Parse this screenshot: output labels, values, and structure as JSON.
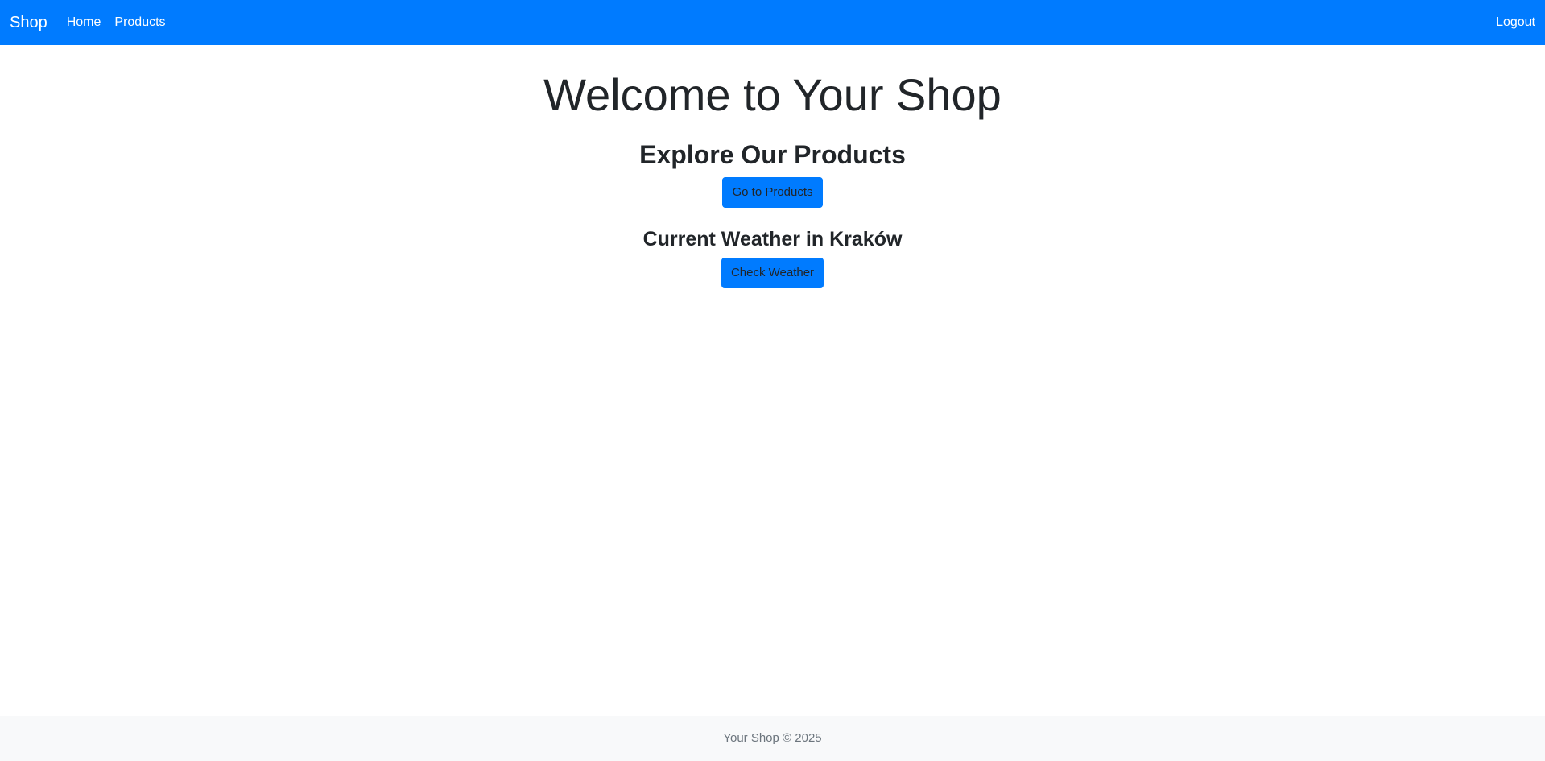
{
  "navbar": {
    "brand": "Shop",
    "links": [
      {
        "label": "Home"
      },
      {
        "label": "Products"
      }
    ],
    "logout": "Logout"
  },
  "main": {
    "title": "Welcome to Your Shop",
    "products_section": {
      "heading": "Explore Our Products",
      "button": "Go to Products"
    },
    "weather_section": {
      "heading": "Current Weather in Kraków",
      "button": "Check Weather"
    }
  },
  "footer": {
    "text": "Your Shop © 2025"
  },
  "colors": {
    "primary": "#007bff",
    "footer_bg": "#f8f9fa",
    "text": "#212529",
    "muted": "#6c757d"
  }
}
